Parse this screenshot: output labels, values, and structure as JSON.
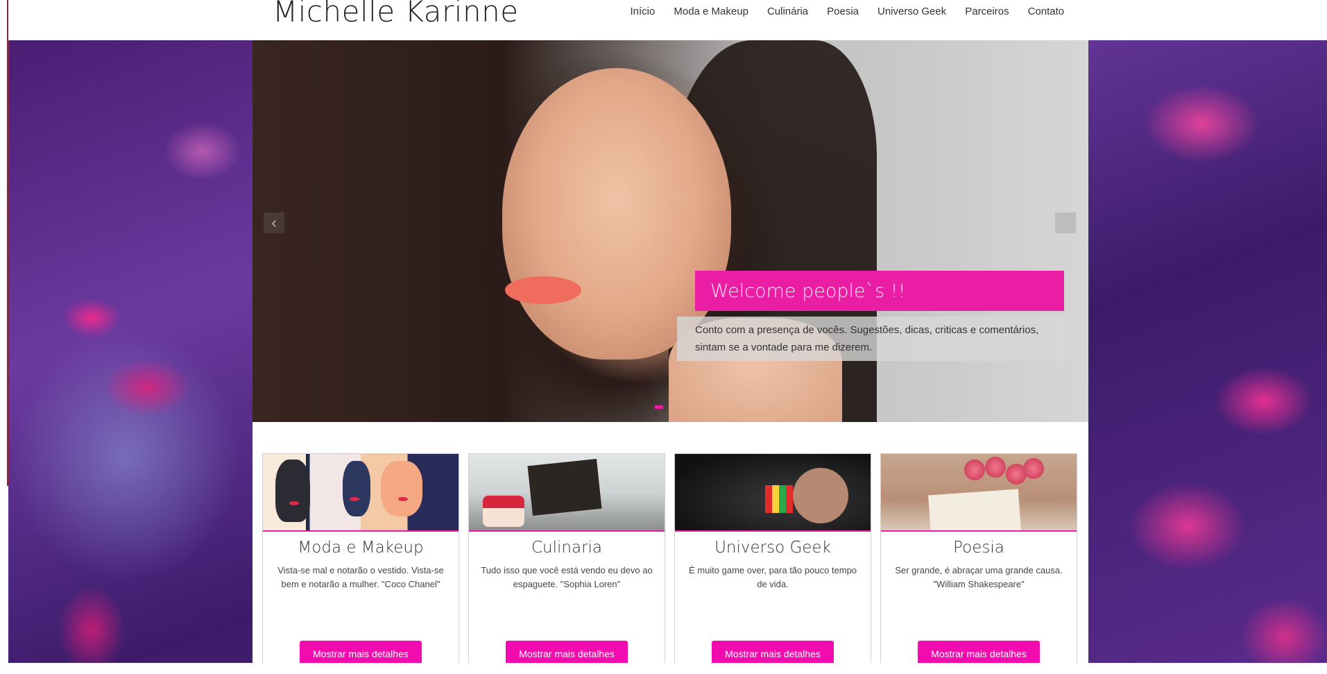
{
  "site": {
    "brand": "Michelle Karinne"
  },
  "nav": {
    "items": [
      "Início",
      "Moda e Makeup",
      "Culinária",
      "Poesia",
      "Universo Geek",
      "Parceiros",
      "Contato"
    ]
  },
  "carousel": {
    "prev_icon": "chevron-left-icon",
    "next_icon": "chevron-right-icon",
    "prev_glyph": "‹",
    "next_glyph": "›",
    "caption_title": "Welcome people`s !!",
    "caption_text": "Conto com a presença de vocês. Sugestões, dicas, criticas e comentários, sintam se a vontade para me dizerem.",
    "accent": "#e91ea5"
  },
  "cards": [
    {
      "title": "Moda e Makeup",
      "text": "Vista-se mal e notarão o vestido. Vista-se bem e notarão a mulher. \"Coco Chanel\"",
      "button": "Mostrar mais detalhes"
    },
    {
      "title": "Culinaria",
      "text": "Tudo isso que você está vendo eu devo ao espaguete. \"Sophia Loren\"",
      "button": "Mostrar mais detalhes"
    },
    {
      "title": "Universo Geek",
      "text": "É muito game over, para tão pouco tempo de vida.",
      "button": "Mostrar mais detalhes"
    },
    {
      "title": "Poesia",
      "text": "Ser grande, é abraçar uma grande causa. \"William Shakespeare\"",
      "button": "Mostrar mais detalhes"
    }
  ],
  "colors": {
    "button": "#f20cb0",
    "accent": "#e91ea5"
  }
}
